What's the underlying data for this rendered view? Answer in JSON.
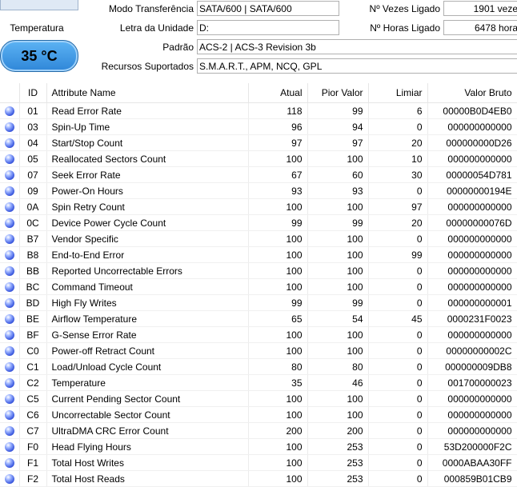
{
  "temperature": {
    "title": "Temperatura",
    "value": "35 °C"
  },
  "info": {
    "transfer_mode_label": "Modo Transferência",
    "transfer_mode_value": "SATA/600 | SATA/600",
    "drive_letter_label": "Letra da Unidade",
    "drive_letter_value": "D:",
    "standard_label": "Padrão",
    "standard_value": "ACS-2 | ACS-3 Revision 3b",
    "features_label": "Recursos Suportados",
    "features_value": "S.M.A.R.T., APM, NCQ, GPL",
    "power_on_count_label": "Nº Vezes Ligado",
    "power_on_count_value": "1901 veze",
    "power_on_hours_label": "Nº Horas Ligado",
    "power_on_hours_value": "6478 hora"
  },
  "table": {
    "headers": [
      "",
      "ID",
      "Attribute Name",
      "Atual",
      "Pior Valor",
      "Limiar",
      "Valor Bruto"
    ],
    "rows": [
      [
        "01",
        "Read Error Rate",
        "118",
        "99",
        "6",
        "00000B0D4EB0"
      ],
      [
        "03",
        "Spin-Up Time",
        "96",
        "94",
        "0",
        "000000000000"
      ],
      [
        "04",
        "Start/Stop Count",
        "97",
        "97",
        "20",
        "000000000D26"
      ],
      [
        "05",
        "Reallocated Sectors Count",
        "100",
        "100",
        "10",
        "000000000000"
      ],
      [
        "07",
        "Seek Error Rate",
        "67",
        "60",
        "30",
        "00000054D781"
      ],
      [
        "09",
        "Power-On Hours",
        "93",
        "93",
        "0",
        "00000000194E"
      ],
      [
        "0A",
        "Spin Retry Count",
        "100",
        "100",
        "97",
        "000000000000"
      ],
      [
        "0C",
        "Device Power Cycle Count",
        "99",
        "99",
        "20",
        "00000000076D"
      ],
      [
        "B7",
        "Vendor Specific",
        "100",
        "100",
        "0",
        "000000000000"
      ],
      [
        "B8",
        "End-to-End Error",
        "100",
        "100",
        "99",
        "000000000000"
      ],
      [
        "BB",
        "Reported Uncorrectable Errors",
        "100",
        "100",
        "0",
        "000000000000"
      ],
      [
        "BC",
        "Command Timeout",
        "100",
        "100",
        "0",
        "000000000000"
      ],
      [
        "BD",
        "High Fly Writes",
        "99",
        "99",
        "0",
        "000000000001"
      ],
      [
        "BE",
        "Airflow Temperature",
        "65",
        "54",
        "45",
        "0000231F0023"
      ],
      [
        "BF",
        "G-Sense Error Rate",
        "100",
        "100",
        "0",
        "000000000000"
      ],
      [
        "C0",
        "Power-off Retract Count",
        "100",
        "100",
        "0",
        "00000000002C"
      ],
      [
        "C1",
        "Load/Unload Cycle Count",
        "80",
        "80",
        "0",
        "000000009DB8"
      ],
      [
        "C2",
        "Temperature",
        "35",
        "46",
        "0",
        "001700000023"
      ],
      [
        "C5",
        "Current Pending Sector Count",
        "100",
        "100",
        "0",
        "000000000000"
      ],
      [
        "C6",
        "Uncorrectable Sector Count",
        "100",
        "100",
        "0",
        "000000000000"
      ],
      [
        "C7",
        "UltraDMA CRC Error Count",
        "200",
        "200",
        "0",
        "000000000000"
      ],
      [
        "F0",
        "Head Flying Hours",
        "100",
        "253",
        "0",
        "53D200000F2C"
      ],
      [
        "F1",
        "Total Host Writes",
        "100",
        "253",
        "0",
        "0000ABAA30FF"
      ],
      [
        "F2",
        "Total Host Reads",
        "100",
        "253",
        "0",
        "000859B01CB9"
      ]
    ],
    "status_icon": "blue-status-dot-icon",
    "status_color": "#3c5ae0"
  }
}
